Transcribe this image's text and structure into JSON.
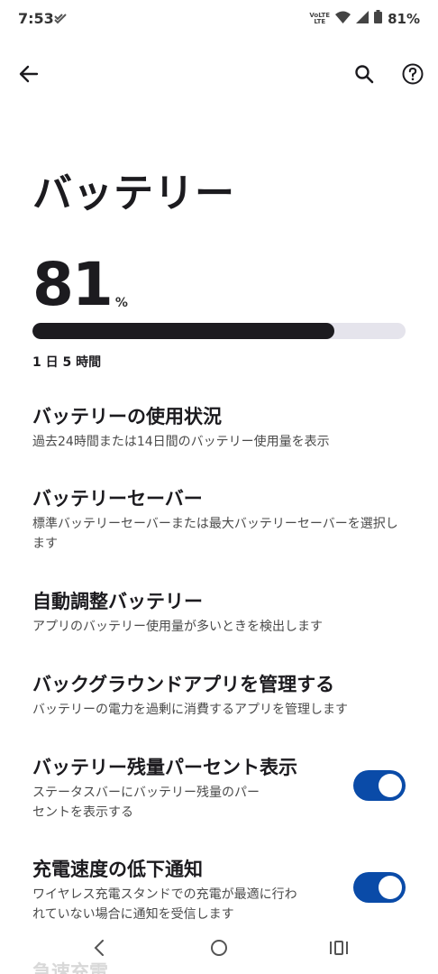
{
  "status_bar": {
    "time": "7:53",
    "volte_line1": "VoLTE",
    "volte_line2": "LTE",
    "battery_percent": "81%"
  },
  "app_bar": {
    "back_icon": "arrow-back-icon",
    "search_icon": "search-icon",
    "help_icon": "help-circle-icon"
  },
  "page": {
    "title": "バッテリー",
    "level_value": "81",
    "level_unit": "%",
    "level_fraction": 0.81,
    "remaining": "1 日 5 時間"
  },
  "items": [
    {
      "title": "バッテリーの使用状況",
      "subtitle": "過去24時間または14日間のバッテリー使用量を表示"
    },
    {
      "title": "バッテリーセーバー",
      "subtitle": "標準バッテリーセーバーまたは最大バッテリーセーバーを選択します"
    },
    {
      "title": "自動調整バッテリー",
      "subtitle": "アプリのバッテリー使用量が多いときを検出します"
    },
    {
      "title": "バックグラウンドアプリを管理する",
      "subtitle": "バッテリーの電力を過剰に消費するアプリを管理します"
    },
    {
      "title": "バッテリー残量パーセント表示",
      "subtitle": "ステータスバーにバッテリー残量のパーセントを表示する",
      "toggle": true
    },
    {
      "title": "充電速度の低下通知",
      "subtitle": "ワイヤレス充電スタンドでの充電が最適に行われていない場合に通知を受信します",
      "toggle": true
    }
  ],
  "partial_item_title": "急速充電",
  "colors": {
    "accent_toggle": "#0a4ba8",
    "progress_fill": "#1c1b1f",
    "progress_track": "#e5e4ec"
  },
  "nav_bar": {
    "back_icon": "nav-back-icon",
    "home_icon": "nav-home-icon",
    "recents_icon": "nav-recents-icon"
  }
}
